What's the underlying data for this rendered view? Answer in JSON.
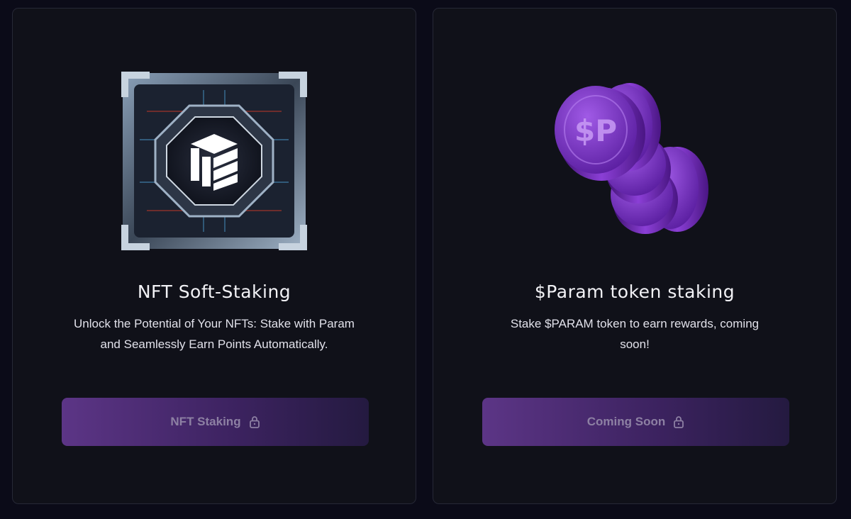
{
  "cards": [
    {
      "title": "NFT Soft-Staking",
      "description": "Unlock the Potential of Your NFTs: Stake with Param and Seamlessly Earn Points Automatically.",
      "button_label": "NFT Staking",
      "button_icon": "lock-icon",
      "button_locked": true,
      "image": "nft-core-artwork"
    },
    {
      "title": "$Param token staking",
      "description": "Stake $PARAM token to earn rewards, coming soon!",
      "button_label": "Coming Soon",
      "button_icon": "lock-icon",
      "button_locked": true,
      "image": "param-coins-artwork",
      "coin_symbol": "$P"
    }
  ],
  "colors": {
    "background": "#0b0b18",
    "card": "#101119",
    "button_gradient_start": "#5c3586",
    "button_gradient_end": "#241a40",
    "button_text": "#8d80a3",
    "coin": "#7a2fc4"
  }
}
